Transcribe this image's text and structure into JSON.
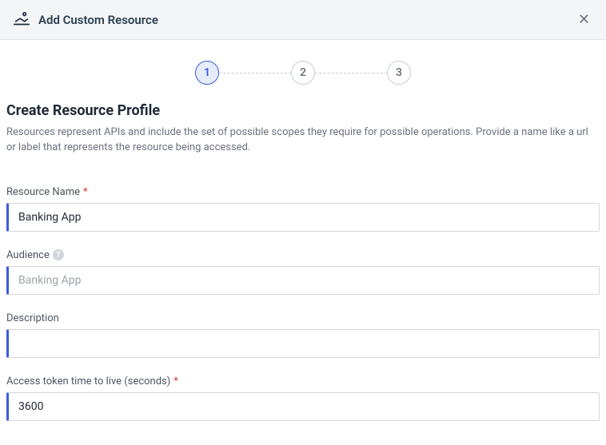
{
  "header": {
    "title": "Add Custom Resource"
  },
  "stepper": {
    "steps": [
      "1",
      "2",
      "3"
    ],
    "active": 0
  },
  "section": {
    "title": "Create Resource Profile",
    "description": "Resources represent APIs and include the set of possible scopes they require for possible operations. Provide a name like a url or label that represents the resource being accessed."
  },
  "form": {
    "resourceName": {
      "label": "Resource Name",
      "required": true,
      "value": "Banking App"
    },
    "audience": {
      "label": "Audience",
      "hasHelp": true,
      "placeholder": "Banking App",
      "value": ""
    },
    "description": {
      "label": "Description",
      "value": ""
    },
    "ttl": {
      "label": "Access token time to live (seconds)",
      "required": true,
      "value": "3600"
    }
  }
}
